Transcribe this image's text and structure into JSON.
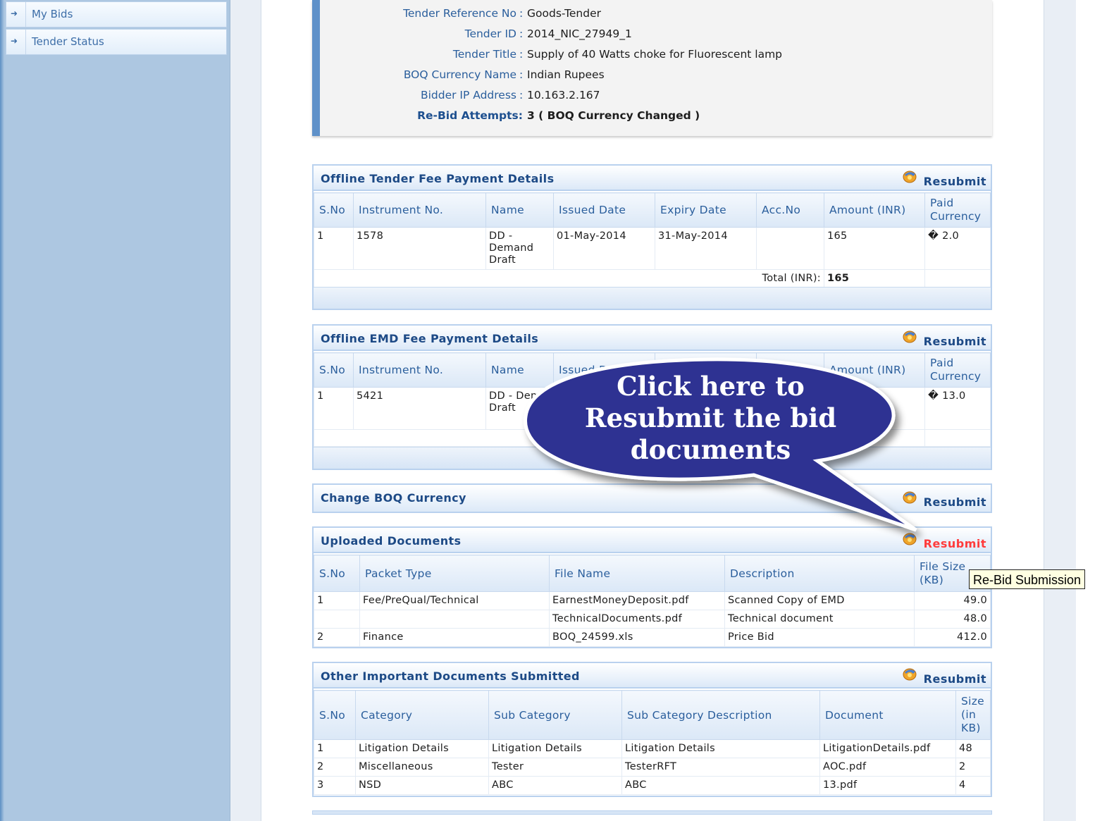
{
  "sidebar": {
    "items": [
      {
        "label": "My Bids"
      },
      {
        "label": "Tender Status"
      }
    ]
  },
  "info": {
    "rows": [
      {
        "key": "Tender Reference No",
        "value": "Goods-Tender"
      },
      {
        "key": "Tender ID",
        "value": "2014_NIC_27949_1"
      },
      {
        "key": "Tender Title",
        "value": "Supply of 40 Watts choke for Fluorescent lamp"
      },
      {
        "key": "BOQ Currency Name",
        "value": "Indian Rupees"
      },
      {
        "key": "Bidder IP Address",
        "value": "10.163.2.167"
      },
      {
        "key": "Re-Bid Attempts:",
        "value": "3 ( BOQ Currency Changed )"
      }
    ]
  },
  "resubmit_label": "Resubmit",
  "fee_panel": {
    "title": "Offline Tender Fee Payment Details",
    "headers": [
      "S.No",
      "Instrument No.",
      "Name",
      "Issued Date",
      "Expiry Date",
      "Acc.No",
      "Amount (INR)",
      "Paid Currency"
    ],
    "row": {
      "sno": "1",
      "instrument": "1578",
      "name": "DD - Demand Draft",
      "issued": "01-May-2014",
      "expiry": "31-May-2014",
      "acc": "",
      "amount": "165",
      "paid": "� 2.0"
    },
    "total_label": "Total (INR):",
    "total_value": "165"
  },
  "emd_panel": {
    "title": "Offline EMD Fee Payment Details",
    "headers": [
      "S.No",
      "Instrument No.",
      "Name",
      "Issued D",
      "Amount (INR)",
      "Paid Currency"
    ],
    "row": {
      "sno": "1",
      "instrument": "5421",
      "name": "DD - Dema Draft",
      "paid": "� 13.0"
    }
  },
  "boq_panel": {
    "title": "Change BOQ Currency"
  },
  "uploaded_panel": {
    "title": "Uploaded Documents",
    "headers": [
      "S.No",
      "Packet Type",
      "File Name",
      "Description",
      "File Size (KB)"
    ],
    "rows": [
      {
        "sno": "1",
        "packet": "Fee/PreQual/Technical",
        "file": "EarnestMoneyDeposit.pdf",
        "desc": "Scanned Copy of EMD",
        "size": "49.0"
      },
      {
        "sno": "",
        "packet": "",
        "file": "TechnicalDocuments.pdf",
        "desc": "Technical document",
        "size": "48.0"
      },
      {
        "sno": "2",
        "packet": "Finance",
        "file": "BOQ_24599.xls",
        "desc": "Price Bid",
        "size": "412.0"
      }
    ]
  },
  "other_panel": {
    "title": "Other Important Documents Submitted",
    "headers": [
      "S.No",
      "Category",
      "Sub Category",
      "Sub Category Description",
      "Document",
      "Size (in KB)"
    ],
    "rows": [
      {
        "sno": "1",
        "cat": "Litigation Details",
        "sub": "Litigation Details",
        "subdesc": "Litigation Details",
        "doc": "LitigationDetails.pdf",
        "size": "48"
      },
      {
        "sno": "2",
        "cat": "Miscellaneous",
        "sub": "Tester",
        "subdesc": "TesterRFT",
        "doc": "AOC.pdf",
        "size": "2"
      },
      {
        "sno": "3",
        "cat": "NSD",
        "sub": "ABC",
        "subdesc": "ABC",
        "doc": "13.pdf",
        "size": "4"
      }
    ]
  },
  "callout": {
    "text": "Click here to Resubmit the bid documents",
    "line1": "Click here to",
    "line2": "Resubmit the bid",
    "line3": "documents",
    "color": "#2e3192"
  },
  "tooltip": "Re-Bid Submission"
}
